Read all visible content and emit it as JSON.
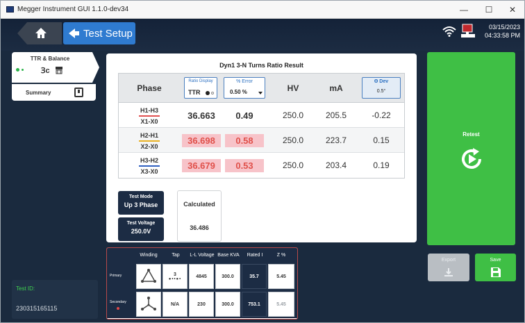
{
  "window": {
    "title": "Megger Instrument GUI 1.1.0-dev34",
    "minimize": "—",
    "maximize": "☐",
    "close": "✕"
  },
  "header": {
    "back_label": "Test Setup",
    "date": "03/15/2023",
    "time": "04:33:58 PM"
  },
  "sidebar": {
    "tab_label": "TTR & Balance",
    "tab_symbol": "Ɜc",
    "summary_label": "Summary",
    "test_id_label": "Test ID:",
    "test_id_value": "230315165115"
  },
  "result": {
    "title": "Dyn1 3-N Turns Ratio Result",
    "columns": {
      "phase": "Phase",
      "ratio_display_label": "Ratio Display",
      "ratio_display_value": "TTR",
      "error_label": "% Error",
      "error_value": "0.50 %",
      "hv": "HV",
      "ma": "mA",
      "dev_label": "Θ Dev",
      "dev_value": "0.5°"
    },
    "rows": [
      {
        "top": "H1-H3",
        "bottom": "X1-X0",
        "line_color": "#e05050",
        "ttr": "36.663",
        "error": "0.49",
        "hv": "250.0",
        "ma": "205.5",
        "dev": "-0.22",
        "flag": false
      },
      {
        "top": "H2-H1",
        "bottom": "X2-X0",
        "line_color": "#e8b020",
        "ttr": "36.698",
        "error": "0.58",
        "hv": "250.0",
        "ma": "223.7",
        "dev": "0.15",
        "flag": true
      },
      {
        "top": "H3-H2",
        "bottom": "X3-X0",
        "line_color": "#3060c0",
        "ttr": "36.679",
        "error": "0.53",
        "hv": "250.0",
        "ma": "203.4",
        "dev": "0.19",
        "flag": true
      }
    ]
  },
  "test_mode": {
    "label": "Test Mode",
    "value": "Up 3 Phase"
  },
  "test_voltage": {
    "label": "Test Voltage",
    "value": "250.0V"
  },
  "calculated": {
    "label": "Calculated",
    "value": "36.486"
  },
  "actions": {
    "retest": "Retest",
    "export": "Export",
    "save": "Save"
  },
  "specs": {
    "headers": [
      "Winding",
      "Tap",
      "L-L Voltage",
      "Base KVA",
      "Rated I",
      "Z %"
    ],
    "primary": {
      "label": "Primary",
      "tap": "3",
      "voltage": "4845",
      "kva": "300.0",
      "rated_i": "35.7",
      "z": "5.45"
    },
    "secondary": {
      "label": "Secondary",
      "tap": "N/A",
      "voltage": "230",
      "kva": "300.0",
      "rated_i": "753.1",
      "z": "5.45"
    }
  },
  "colors": {
    "accent_green": "#3fbf45",
    "navy": "#1c2c44",
    "blue": "#2f7bd0",
    "error_red": "#e0504a",
    "error_bg": "#f7c3c9"
  }
}
